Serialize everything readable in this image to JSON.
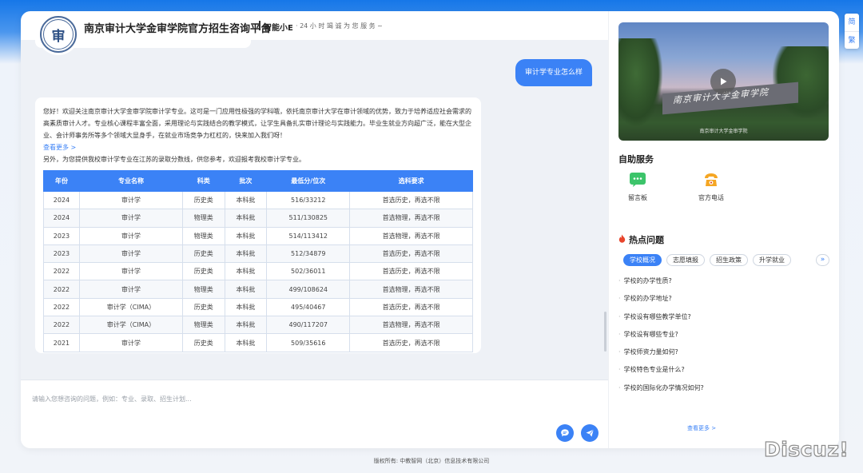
{
  "header": {
    "logo_char": "审",
    "site_title": "南京审计大学金审学院官方招生咨询平台",
    "bot_name": "智能小E",
    "bot_tagline": "· 24 小 时 竭 诚 为 您 服 务 ~"
  },
  "chat": {
    "user_message": "审计学专业怎么样",
    "bot_intro": "您好！欢迎关注南京审计大学金审学院审计学专业。这可是一门应用性极强的学科哦，依托南京审计大学在审计领域的优势，致力于培养适应社会需求的高素质审计人才。专业核心课程丰富全面，采用理论与实践结合的教学模式，让学生具备扎实审计理论与实践能力。毕业生就业方向超广泛，能在大型企业、会计师事务所等多个领域大显身手，在就业市场竞争力杠杠的，快来加入我们呀！",
    "more_link": "查看更多 >",
    "bot_followup": "另外，为您提供我校审计学专业在江苏的录取分数线，供您参考，欢迎报考我校审计学专业。",
    "table": {
      "headers": [
        "年份",
        "专业名称",
        "科类",
        "批次",
        "最低分/位次",
        "选科要求"
      ],
      "rows": [
        [
          "2024",
          "审计学",
          "历史类",
          "本科批",
          "516/33212",
          "首选历史，再选不限"
        ],
        [
          "2024",
          "审计学",
          "物理类",
          "本科批",
          "511/130825",
          "首选物理，再选不限"
        ],
        [
          "2023",
          "审计学",
          "物理类",
          "本科批",
          "514/113412",
          "首选物理，再选不限"
        ],
        [
          "2023",
          "审计学",
          "历史类",
          "本科批",
          "512/34879",
          "首选历史，再选不限"
        ],
        [
          "2022",
          "审计学",
          "历史类",
          "本科批",
          "502/36011",
          "首选历史，再选不限"
        ],
        [
          "2022",
          "审计学",
          "物理类",
          "本科批",
          "499/108624",
          "首选物理，再选不限"
        ],
        [
          "2022",
          "审计学（CIMA）",
          "历史类",
          "本科批",
          "495/40467",
          "首选历史，再选不限"
        ],
        [
          "2022",
          "审计学（CIMA）",
          "物理类",
          "本科批",
          "490/117207",
          "首选物理，再选不限"
        ],
        [
          "2021",
          "审计学",
          "历史类",
          "本科批",
          "509/35616",
          "首选历史，再选不限"
        ]
      ]
    },
    "input_placeholder": "请输入您想咨询的问题，例如：专业、录取、招生计划..."
  },
  "sidebar": {
    "video_wall_text": "南京审计大学金审学院",
    "video_caption": "南京审计大学金审学院",
    "self_service_title": "自助服务",
    "services": [
      {
        "label": "留言板",
        "icon": "message-board-icon",
        "color": "#3cc46a"
      },
      {
        "label": "官方电话",
        "icon": "phone-icon",
        "color": "#f5a623"
      }
    ],
    "hot_title": "热点问题",
    "hot_tabs": [
      "学校概况",
      "志愿填报",
      "招生政策",
      "升学就业"
    ],
    "questions": [
      "学校的办学性质?",
      "学校的办学地址?",
      "学校设有哪些教学单位?",
      "学校设有哪些专业?",
      "学校师资力量如何?",
      "学校特色专业是什么?",
      "学校的国际化办学情况如何?"
    ],
    "see_more": "查看更多 >"
  },
  "lang": {
    "simplified": "简",
    "traditional": "繁"
  },
  "footer": "版权所有: 中教智网（北京）信息技术有限公司",
  "watermark": "Discuz!",
  "colors": {
    "accent": "#3b82f6",
    "hot_flame": "#e8452c"
  }
}
